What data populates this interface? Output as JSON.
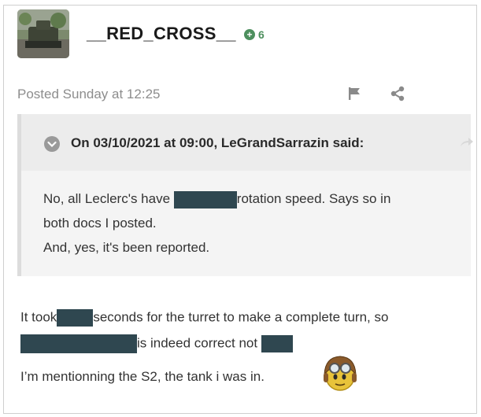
{
  "post": {
    "username": "__RED_CROSS__",
    "reputation": "6",
    "posted": "Posted Sunday at 12:25",
    "quote": {
      "header": "On 03/10/2021 at 09:00, LeGrandSarrazin said:",
      "line1_a": "No, all Leclerc's have",
      "line1_b": "rotation speed. Says so in",
      "line2": "both docs I posted.",
      "line3": "And, yes, it's been reported."
    },
    "body": {
      "line1_a": "It took",
      "line1_b": "seconds for the turret to make a complete turn, so",
      "line2_a": "is indeed correct not",
      "line3": "I’m mentionning the S2, the tank i was in."
    }
  }
}
